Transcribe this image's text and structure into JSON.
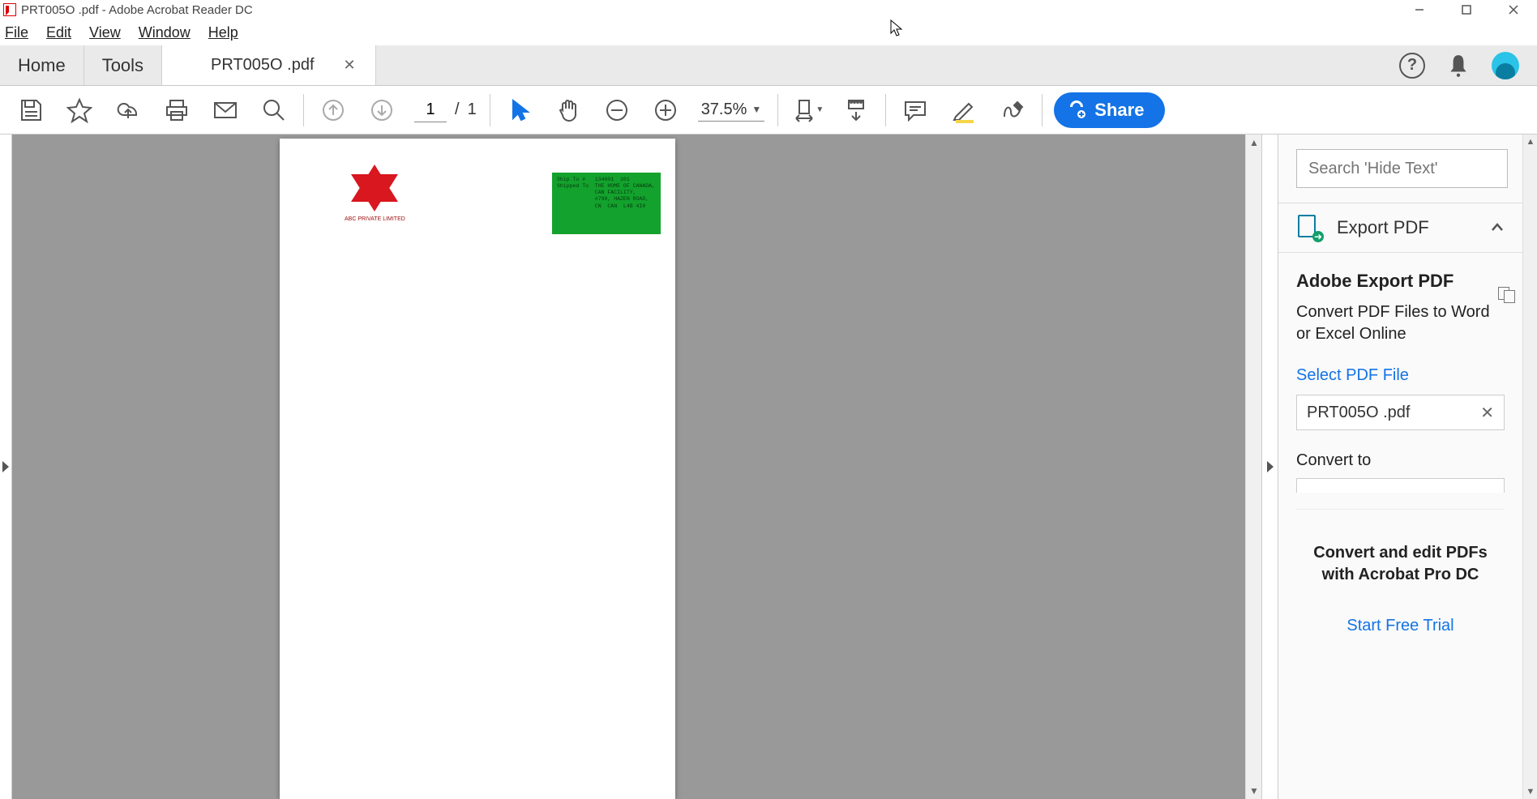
{
  "title": "PRT005O  .pdf - Adobe Acrobat Reader DC",
  "menu": {
    "file": "File",
    "edit": "Edit",
    "view": "View",
    "window": "Window",
    "help": "Help"
  },
  "tabs": {
    "home": "Home",
    "tools": "Tools",
    "doc": "PRT005O  .pdf"
  },
  "toolbar": {
    "page_current": "1",
    "page_sep": "/",
    "page_total": "1",
    "zoom": "37.5%"
  },
  "share_label": "Share",
  "document": {
    "logo_caption": "ABC PRIVATE LIMITED",
    "shipbox": "Ship To #   134001  101\nShipped To  THE HOME OF CANADA,\n            CAN FACILITY,\n            #790, HAZEN ROAD,\n            CN  CAN  L4B 4I0"
  },
  "right_panel": {
    "search_placeholder": "Search 'Hide Text'",
    "export_header": "Export PDF",
    "h3": "Adobe Export PDF",
    "sub": "Convert PDF Files to Word or Excel Online",
    "select_label": "Select PDF File",
    "selected_file": "PRT005O .pdf",
    "convert_label": "Convert to",
    "promo_line": "Convert and edit PDFs with Acrobat Pro DC",
    "promo_link": "Start Free Trial"
  }
}
